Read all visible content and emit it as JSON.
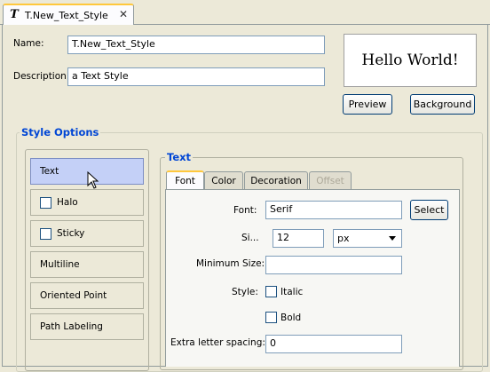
{
  "tab": {
    "icon": "text-style-icon",
    "title": "T.New_Text_Style"
  },
  "form": {
    "name_label": "Name:",
    "name_value": "T.New_Text_Style",
    "description_label": "Description:",
    "description_value": "a Text Style"
  },
  "preview": {
    "text": "Hello World!",
    "preview_button": "Preview",
    "background_button": "Background"
  },
  "style_options": {
    "title": "Style Options",
    "items": [
      {
        "label": "Text",
        "checkbox": false,
        "selected": true
      },
      {
        "label": "Halo",
        "checkbox": true,
        "selected": false
      },
      {
        "label": "Sticky",
        "checkbox": true,
        "selected": false
      },
      {
        "label": "Multiline",
        "checkbox": false,
        "selected": false
      },
      {
        "label": "Oriented Point",
        "checkbox": false,
        "selected": false
      },
      {
        "label": "Path Labeling",
        "checkbox": false,
        "selected": false
      }
    ]
  },
  "text_panel": {
    "title": "Text",
    "tabs": [
      {
        "label": "Font",
        "active": true,
        "enabled": true
      },
      {
        "label": "Color",
        "active": false,
        "enabled": true
      },
      {
        "label": "Decoration",
        "active": false,
        "enabled": true
      },
      {
        "label": "Offset",
        "active": false,
        "enabled": false
      }
    ],
    "font_label": "Font:",
    "font_value": "Serif",
    "select_button": "Select",
    "size_label": "Si...",
    "size_value": "12",
    "unit_value": "px",
    "min_size_label": "Minimum Size:",
    "min_size_value": "",
    "style_label": "Style:",
    "italic_label": "Italic",
    "bold_label": "Bold",
    "letter_spacing_label": "Extra letter spacing:",
    "letter_spacing_value": "0"
  },
  "colors": {
    "accent": "#0046d5",
    "selected": "#c4d0f7",
    "tab_highlight": "#ffc83c"
  }
}
